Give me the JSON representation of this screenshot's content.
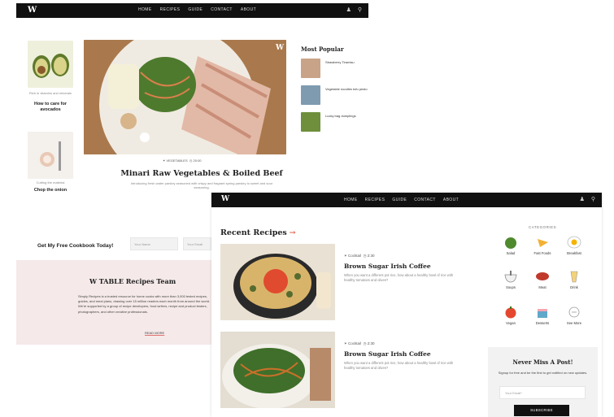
{
  "window_back": {
    "logo": "W",
    "nav": [
      "HOME",
      "RECIPES",
      "GUIDE",
      "CONTACT",
      "ABOUT"
    ],
    "icons": [
      "user-icon",
      "search-icon"
    ],
    "left_cards": [
      {
        "subtitle": "Rich in vitamins and minerals",
        "title": "How to care for avocados"
      },
      {
        "subtitle": "Cutting the material",
        "title": "Chop the onion"
      }
    ],
    "featured": {
      "category": "VEGETABLES",
      "time": "20:00",
      "title": "Minari Raw Vegetables & Boiled Beef",
      "description": "Introducing fresh water parsley seasoned with crispy and fragrant spring parsley to sweet and sour seasoning."
    },
    "most_popular": {
      "heading": "Most Popular",
      "items": [
        "Strawberry Tiramisu",
        "Vegetable noodles tofu pesto",
        "Lucky bag dumplings"
      ]
    },
    "cookbook": {
      "heading": "Get My Free Cookbook Today!",
      "name_placeholder": "Your Name",
      "email_placeholder": "Your Email"
    },
    "team": {
      "heading": "W TABLE Recipes Team",
      "body": "Simply Recipes is a trusted resource for home cooks with more than 3,000 tested recipes, guides, and meal plans, drawing over 15 million readers each month from around the world. We're supported by a group of recipe developers, food writers, recipe and product testers, photographers, and other creative professionals.",
      "link": "READ MORE"
    }
  },
  "window_front": {
    "logo": "W",
    "nav": [
      "HOME",
      "RECIPES",
      "GUIDE",
      "CONTACT",
      "ABOUT"
    ],
    "recent_heading": "Recent Recipes",
    "recipes": [
      {
        "category": "Cocktail",
        "time": "2:30",
        "title": "Brown Sugar Irish Coffee",
        "description": "When you want a different pot rice, how about a healthy bowl of rice with healthy tomatoes and olives?"
      },
      {
        "category": "Cocktail",
        "time": "2:30",
        "title": "Brown Sugar Irish Coffee",
        "description": "When you want a different pot rice, how about a healthy bowl of rice with healthy tomatoes and olives?"
      }
    ],
    "categories": {
      "heading": "CATEGORIES",
      "items": [
        "Salad",
        "Fast Foods",
        "Breakfast",
        "Soups",
        "Meat",
        "Drink",
        "Vegan",
        "Desserts",
        "See More"
      ]
    },
    "newsletter": {
      "heading": "Never Miss A Post!",
      "description": "Signup for free and be the first to get notified on new updates.",
      "email_placeholder": "Your Email*",
      "button": "SUBSCRIBE"
    }
  }
}
